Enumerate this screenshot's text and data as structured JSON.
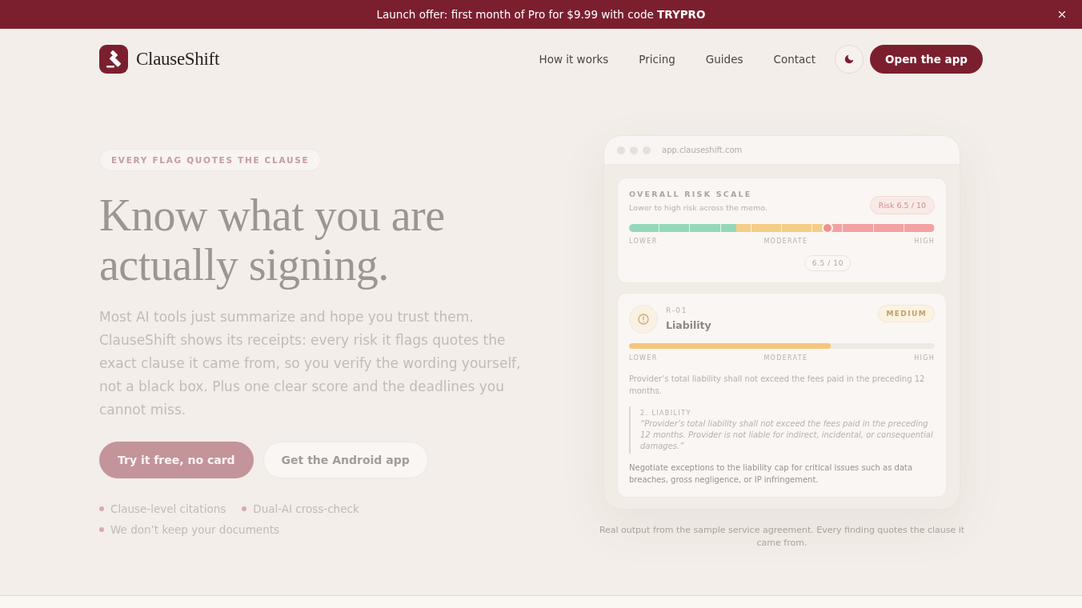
{
  "banner": {
    "text": "Launch offer: first month of Pro for $9.99 with code **TRYPRO**"
  },
  "header": {
    "brand": "ClauseShift",
    "nav": [
      {
        "label": "How it works"
      },
      {
        "label": "Pricing"
      },
      {
        "label": "Guides"
      },
      {
        "label": "Contact"
      }
    ],
    "cta": "Open the app"
  },
  "hero": {
    "eyebrow": "EVERY FLAG QUOTES THE CLAUSE",
    "headline": "Know what you are actually signing.",
    "lead": "Most AI tools just summarize and hope you trust them. ClauseShift shows its receipts: every risk it flags quotes the exact clause it came from, so you verify the wording yourself, not a black box. Plus one clear score and the deadlines you cannot miss.",
    "buttons": [
      {
        "label": "Try it free, no card",
        "kind": "primary"
      },
      {
        "label": "Get the Android app",
        "kind": "secondary"
      }
    ],
    "features": [
      "Clause-level citations",
      "Dual-AI cross-check",
      "We don’t keep your documents"
    ]
  },
  "preview": {
    "url": "app.clauseshift.com",
    "risk": {
      "title": "OVERALL RISK SCALE",
      "subtitle": "Lower to high risk across the memo.",
      "badge": "Risk 6.5 / 10",
      "level": 0.65,
      "scale_labels": [
        "LOWER",
        "MODERATE",
        "HIGH"
      ],
      "value": "6.5 / 10"
    },
    "finding": {
      "id": "R-01",
      "title": "Liability",
      "severity": "MEDIUM",
      "level": 0.66,
      "scale_labels": [
        "LOWER",
        "MODERATE",
        "HIGH"
      ],
      "summary": "Provider’s total liability shall not exceed the fees paid in the preceding 12 months.",
      "clause_heading": "2. LIABILITY",
      "quote": "“Provider’s total liability shall not exceed the fees paid in the preceding 12 months. Provider is not liable for indirect, incidental, or consequential damages.”",
      "recommendation": "Negotiate exceptions to the liability cap for critical issues such as data breaches, gross negligence, or IP infringement."
    },
    "caption": "Real output from the sample service agreement. Every finding quotes the clause it came from."
  }
}
